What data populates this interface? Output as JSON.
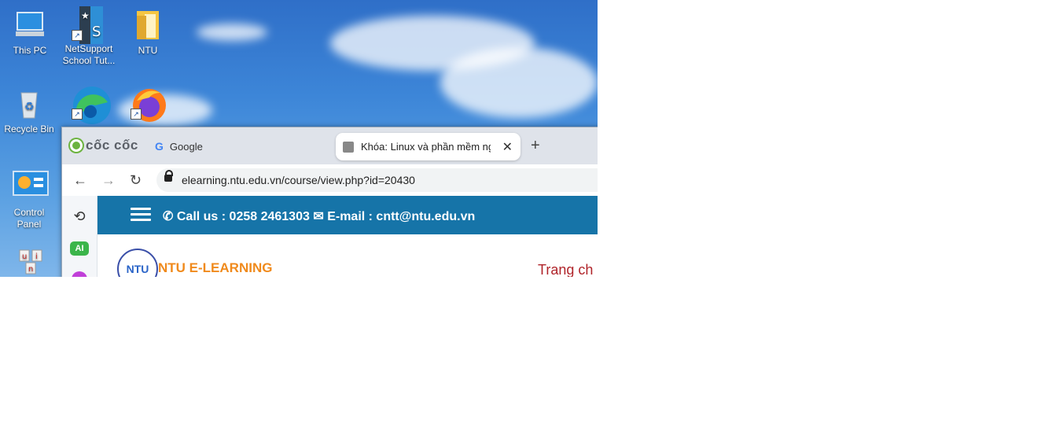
{
  "desktop": {
    "icons": [
      {
        "label": "This PC",
        "icon": "this-pc-icon"
      },
      {
        "label": "NetSupport School Tut...",
        "icon": "netsupport-icon"
      },
      {
        "label": "NTU",
        "icon": "folder-icon"
      },
      {
        "label": "Recycle Bin",
        "icon": "recycle-bin-icon"
      },
      {
        "label": "",
        "icon": "edge-icon"
      },
      {
        "label": "",
        "icon": "firefox-icon"
      },
      {
        "label": "Control Panel",
        "icon": "control-panel-icon"
      },
      {
        "label": "",
        "icon": "unikey-icon"
      }
    ]
  },
  "browser": {
    "brand": "cốc cốc",
    "tabs": [
      {
        "label": "Google"
      },
      {
        "label": "Khóa: Linux và phần mềm ng"
      }
    ],
    "new_tab": "+",
    "close_tab": "✕",
    "url": "elearning.ntu.edu.vn/course/view.php?id=20430",
    "sidebar_ai": "AI"
  },
  "site": {
    "call_label": "Call us : 0258 2461303",
    "email_label": "E-mail : cntt@ntu.edu.vn",
    "logo_text": "NTU",
    "brand_text": "NTU E-LEARNING",
    "nav_home": "Trang ch"
  },
  "colors": {
    "header_bg": "#1674a8",
    "brand_orange": "#f08a1c",
    "nav_red": "#b0242a"
  }
}
